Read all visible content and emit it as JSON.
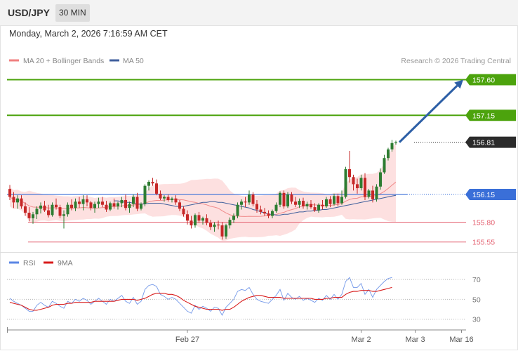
{
  "header": {
    "symbol": "USD/JPY",
    "interval": "30 MIN"
  },
  "datetime": "Monday, March 2, 2026 7:16:59 AM CET",
  "legend": {
    "ma20": "MA 20 + Bollinger Bands",
    "ma50": "MA 50",
    "rsi": "RSI",
    "rsi_ma": "9MA"
  },
  "credit": "Research © 2026 Trading Central",
  "colors": {
    "up": "#2e7d32",
    "down": "#c62828",
    "target": "#4ca30d",
    "pivot": "#3a6fd8",
    "support": "#e46070",
    "band": "#fcd6d6",
    "ma50": "#3f5f9c",
    "rsi": "#5b86e5",
    "rsi_ma": "#d81b1b",
    "arrow": "#2d5fa6"
  },
  "chart_data": [
    {
      "type": "candlestick",
      "ylim": [
        155.45,
        157.72
      ],
      "levels": [
        {
          "label": "157.60",
          "value": 157.6,
          "kind": "target"
        },
        {
          "label": "157.15",
          "value": 157.15,
          "kind": "target"
        },
        {
          "label": "156.81",
          "value": 156.81,
          "kind": "last"
        },
        {
          "label": "156.15",
          "value": 156.15,
          "kind": "pivot"
        },
        {
          "label": "155.80",
          "value": 155.8,
          "kind": "support"
        },
        {
          "label": "155.55",
          "value": 155.55,
          "kind": "support"
        }
      ],
      "arrow": {
        "from": 156.81,
        "to": 157.6
      },
      "candles": [
        [
          156.22,
          156.27,
          156.08,
          156.12
        ],
        [
          156.12,
          156.18,
          155.98,
          156.05
        ],
        [
          156.05,
          156.14,
          155.97,
          156.1
        ],
        [
          156.1,
          156.14,
          155.97,
          156.0
        ],
        [
          156.0,
          156.05,
          155.88,
          155.92
        ],
        [
          155.92,
          155.99,
          155.81,
          155.85
        ],
        [
          155.85,
          155.93,
          155.78,
          155.9
        ],
        [
          155.9,
          156.0,
          155.84,
          155.97
        ],
        [
          155.97,
          156.05,
          155.91,
          156.01
        ],
        [
          156.01,
          156.07,
          155.93,
          155.95
        ],
        [
          155.95,
          156.02,
          155.86,
          155.89
        ],
        [
          155.89,
          156.05,
          155.87,
          156.02
        ],
        [
          156.02,
          156.1,
          155.96,
          155.99
        ],
        [
          155.99,
          156.02,
          155.85,
          155.88
        ],
        [
          155.88,
          155.95,
          155.72,
          155.9
        ],
        [
          155.9,
          156.05,
          155.87,
          156.02
        ],
        [
          156.02,
          156.09,
          155.95,
          155.98
        ],
        [
          155.98,
          156.1,
          155.94,
          156.06
        ],
        [
          156.06,
          156.12,
          155.98,
          156.03
        ],
        [
          156.03,
          156.14,
          155.95,
          156.09
        ],
        [
          156.09,
          156.14,
          156.0,
          156.05
        ],
        [
          156.05,
          156.07,
          155.95,
          155.98
        ],
        [
          155.98,
          156.06,
          155.92,
          156.03
        ],
        [
          156.03,
          156.11,
          155.98,
          156.06
        ],
        [
          156.06,
          156.12,
          155.99,
          156.02
        ],
        [
          156.02,
          156.07,
          155.93,
          155.96
        ],
        [
          155.96,
          156.06,
          155.94,
          156.04
        ],
        [
          156.04,
          156.1,
          155.97,
          156.0
        ],
        [
          156.0,
          156.06,
          155.96,
          156.04
        ],
        [
          156.04,
          156.12,
          155.99,
          156.08
        ],
        [
          156.08,
          156.15,
          155.95,
          155.98
        ],
        [
          155.98,
          156.06,
          155.92,
          156.03
        ],
        [
          156.03,
          156.15,
          155.99,
          156.12
        ],
        [
          156.12,
          156.17,
          155.94,
          155.97
        ],
        [
          155.97,
          156.05,
          155.95,
          156.03
        ],
        [
          156.03,
          156.28,
          156.0,
          156.26
        ],
        [
          156.26,
          156.33,
          156.2,
          156.31
        ],
        [
          156.31,
          156.36,
          156.26,
          156.29
        ],
        [
          156.29,
          156.34,
          156.14,
          156.16
        ],
        [
          156.16,
          156.2,
          156.08,
          156.1
        ],
        [
          156.1,
          156.14,
          156.06,
          156.12
        ],
        [
          156.12,
          156.15,
          156.06,
          156.08
        ],
        [
          156.08,
          156.12,
          156.05,
          156.1
        ],
        [
          156.1,
          156.14,
          156.02,
          156.05
        ],
        [
          156.05,
          156.08,
          155.94,
          155.97
        ],
        [
          155.97,
          156.0,
          155.87,
          155.9
        ],
        [
          155.9,
          155.95,
          155.77,
          155.82
        ],
        [
          155.82,
          155.88,
          155.72,
          155.76
        ],
        [
          155.76,
          155.91,
          155.73,
          155.89
        ],
        [
          155.89,
          155.93,
          155.79,
          155.82
        ],
        [
          155.82,
          155.87,
          155.77,
          155.85
        ],
        [
          155.85,
          155.9,
          155.76,
          155.79
        ],
        [
          155.79,
          155.83,
          155.7,
          155.74
        ],
        [
          155.74,
          155.8,
          155.68,
          155.77
        ],
        [
          155.77,
          155.82,
          155.71,
          155.76
        ],
        [
          155.76,
          155.8,
          155.58,
          155.62
        ],
        [
          155.62,
          155.78,
          155.59,
          155.76
        ],
        [
          155.76,
          155.86,
          155.72,
          155.83
        ],
        [
          155.83,
          155.91,
          155.79,
          155.88
        ],
        [
          155.88,
          156.05,
          155.85,
          156.02
        ],
        [
          156.02,
          156.09,
          155.96,
          156.06
        ],
        [
          156.06,
          156.12,
          155.99,
          156.05
        ],
        [
          156.05,
          156.2,
          156.02,
          156.15
        ],
        [
          156.15,
          156.18,
          156.0,
          156.03
        ],
        [
          156.03,
          156.08,
          155.92,
          155.96
        ],
        [
          155.96,
          156.01,
          155.9,
          155.93
        ],
        [
          155.93,
          155.98,
          155.88,
          155.91
        ],
        [
          155.91,
          155.95,
          155.85,
          155.88
        ],
        [
          155.88,
          155.96,
          155.85,
          155.94
        ],
        [
          155.94,
          156.05,
          155.92,
          156.02
        ],
        [
          156.02,
          156.19,
          155.99,
          156.17
        ],
        [
          156.17,
          156.2,
          155.97,
          156.0
        ],
        [
          156.0,
          156.18,
          155.98,
          156.15
        ],
        [
          156.15,
          156.18,
          156.03,
          156.06
        ],
        [
          156.06,
          156.12,
          155.99,
          156.02
        ],
        [
          156.02,
          156.1,
          155.98,
          156.07
        ],
        [
          156.07,
          156.11,
          155.97,
          156.0
        ],
        [
          156.0,
          156.06,
          155.96,
          156.03
        ],
        [
          156.03,
          156.08,
          155.97,
          155.99
        ],
        [
          155.99,
          156.04,
          155.93,
          155.95
        ],
        [
          155.95,
          156.04,
          155.92,
          156.02
        ],
        [
          156.02,
          156.08,
          155.96,
          156.0
        ],
        [
          156.0,
          156.12,
          155.98,
          156.09
        ],
        [
          156.09,
          156.13,
          155.99,
          156.03
        ],
        [
          156.03,
          156.16,
          156.01,
          156.13
        ],
        [
          156.13,
          156.16,
          156.0,
          156.04
        ],
        [
          156.04,
          156.2,
          156.02,
          156.12
        ],
        [
          156.12,
          156.5,
          156.1,
          156.47
        ],
        [
          156.47,
          156.7,
          156.3,
          156.37
        ],
        [
          156.37,
          156.4,
          156.2,
          156.28
        ],
        [
          156.28,
          156.35,
          156.16,
          156.23
        ],
        [
          156.23,
          156.4,
          156.2,
          156.36
        ],
        [
          156.36,
          156.42,
          156.08,
          156.12
        ],
        [
          156.12,
          156.22,
          156.1,
          156.2
        ],
        [
          156.2,
          156.26,
          156.05,
          156.09
        ],
        [
          156.09,
          156.28,
          156.06,
          156.25
        ],
        [
          156.25,
          156.48,
          156.21,
          156.43
        ],
        [
          156.43,
          156.65,
          156.41,
          156.61
        ],
        [
          156.61,
          156.74,
          156.58,
          156.72
        ],
        [
          156.72,
          156.84,
          156.69,
          156.8
        ],
        [
          156.8,
          156.83,
          156.78,
          156.81
        ]
      ],
      "ma50": [
        156.07,
        156.07,
        156.06,
        156.05,
        156.05,
        156.04,
        156.03,
        156.03,
        156.03,
        156.04,
        156.04,
        156.04,
        156.04,
        156.03,
        156.02,
        156.01,
        156.0,
        156.0,
        156.0,
        156.01,
        156.02,
        156.03,
        156.04,
        156.05,
        156.05,
        156.06,
        156.06,
        156.05,
        156.05,
        156.04,
        156.03,
        156.02,
        156.01,
        156.0,
        155.99,
        155.98,
        155.96,
        155.95,
        155.93,
        155.92,
        155.9,
        155.9,
        155.89,
        155.89,
        155.9,
        155.9,
        155.91,
        155.92,
        155.93,
        155.93,
        155.94,
        155.94,
        155.95,
        155.95,
        155.96,
        155.96,
        155.97,
        155.98,
        155.99,
        156.0,
        156.01,
        156.02,
        156.03,
        156.04,
        156.05,
        156.06,
        156.07,
        156.08,
        156.09,
        156.1,
        156.11,
        156.12,
        156.13,
        156.14
      ],
      "ma50_start": 27,
      "rsi_ylim": [
        22,
        80
      ],
      "rsi_ticks": [
        "70",
        "50",
        "30"
      ],
      "rsi": [
        51,
        48,
        46,
        44,
        41,
        38,
        38,
        44,
        47,
        44,
        42,
        48,
        46,
        43,
        41,
        48,
        46,
        50,
        48,
        51,
        49,
        45,
        48,
        51,
        48,
        45,
        50,
        48,
        51,
        54,
        48,
        46,
        52,
        45,
        48,
        60,
        64,
        65,
        63,
        55,
        53,
        50,
        52,
        50,
        46,
        42,
        38,
        36,
        44,
        40,
        43,
        41,
        38,
        42,
        41,
        34,
        42,
        46,
        50,
        58,
        60,
        59,
        62,
        55,
        50,
        48,
        47,
        46,
        50,
        54,
        60,
        49,
        56,
        52,
        50,
        53,
        49,
        51,
        49,
        47,
        51,
        49,
        54,
        50,
        55,
        50,
        55,
        68,
        72,
        62,
        62,
        66,
        55,
        60,
        52,
        60,
        64,
        68,
        71,
        72
      ],
      "rsi_ma": [
        47,
        46,
        45,
        44,
        42,
        40,
        39,
        39,
        40,
        41,
        42,
        44,
        45,
        45,
        45,
        46,
        46,
        47,
        47,
        47,
        47,
        47,
        48,
        48,
        48,
        48,
        48,
        48,
        49,
        50,
        50,
        50,
        50,
        49,
        50,
        51,
        53,
        55,
        56,
        56,
        56,
        55,
        55,
        54,
        52,
        49,
        47,
        45,
        43,
        42,
        41,
        40,
        40,
        40,
        40,
        39,
        40,
        40,
        42,
        45,
        48,
        50,
        52,
        53,
        54,
        54,
        53,
        52,
        52,
        52,
        52,
        51,
        51,
        51,
        51,
        51,
        51,
        51,
        51,
        50,
        50,
        50,
        51,
        51,
        52,
        52,
        52,
        55,
        57,
        58,
        58,
        59,
        59,
        59,
        58,
        58,
        59,
        60,
        61,
        62
      ],
      "x_ticks": [
        {
          "label": "Feb 27",
          "index": 46
        },
        {
          "label": "Mar 2",
          "index": 91
        },
        {
          "label": "Mar 3",
          "index": 105
        },
        {
          "label": "Mar 16",
          "index": 117
        }
      ]
    }
  ]
}
